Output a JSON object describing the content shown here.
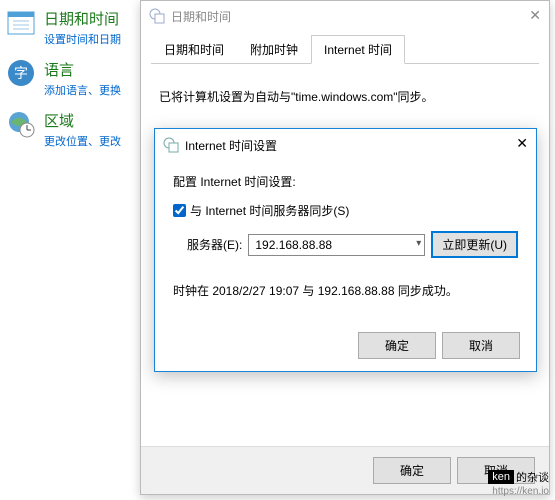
{
  "sidebar": {
    "items": [
      {
        "title": "日期和时间",
        "sub": "设置时间和日期"
      },
      {
        "title": "语言",
        "sub": "添加语言、更换"
      },
      {
        "title": "区域",
        "sub": "更改位置、更改"
      }
    ]
  },
  "window": {
    "title": "日期和时间",
    "tabs": [
      {
        "label": "日期和时间",
        "active": false
      },
      {
        "label": "附加时钟",
        "active": false
      },
      {
        "label": "Internet 时间",
        "active": true
      }
    ],
    "body_text": "已将计算机设置为自动与\"time.windows.com\"同步。",
    "footer": {
      "ok": "确定",
      "cancel": "取消"
    }
  },
  "dialog": {
    "title": "Internet 时间设置",
    "heading": "配置 Internet 时间设置:",
    "checkbox_label": "与 Internet 时间服务器同步(S)",
    "checkbox_checked": true,
    "server_label": "服务器(E):",
    "server_value": "192.168.88.88",
    "update_btn": "立即更新(U)",
    "status": "时钟在 2018/2/27 19:07 与 192.168.88.88 同步成功。",
    "ok": "确定",
    "cancel": "取消"
  },
  "watermark": {
    "badge": "ken",
    "text": "的杂谈",
    "url": "https://ken.io"
  }
}
